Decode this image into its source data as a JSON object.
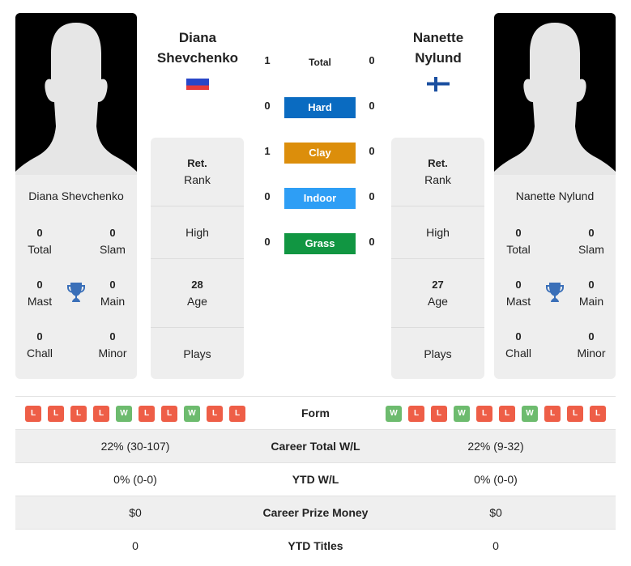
{
  "players": [
    {
      "name": "Diana Shevchenko",
      "name_line1": "Diana",
      "name_line2": "Shevchenko",
      "flag": "russia-flag",
      "titles": {
        "total": "0",
        "slam": "0",
        "mast": "0",
        "main": "0",
        "chall": "0",
        "minor": "0"
      },
      "info": {
        "rank_value": "Ret.",
        "rank_label": "Rank",
        "high_label": "High",
        "age_value": "28",
        "age_label": "Age",
        "plays_label": "Plays"
      },
      "form": [
        "L",
        "L",
        "L",
        "L",
        "W",
        "L",
        "L",
        "W",
        "L",
        "L"
      ],
      "career_wl": "22% (30-107)",
      "ytd_wl": "0% (0-0)",
      "prize_money": "$0",
      "ytd_titles": "0"
    },
    {
      "name": "Nanette Nylund",
      "name_line1": "Nanette",
      "name_line2": "Nylund",
      "flag": "finland-flag",
      "titles": {
        "total": "0",
        "slam": "0",
        "mast": "0",
        "main": "0",
        "chall": "0",
        "minor": "0"
      },
      "info": {
        "rank_value": "Ret.",
        "rank_label": "Rank",
        "high_label": "High",
        "age_value": "27",
        "age_label": "Age",
        "plays_label": "Plays"
      },
      "form": [
        "W",
        "L",
        "L",
        "W",
        "L",
        "L",
        "W",
        "L",
        "L",
        "L"
      ],
      "career_wl": "22% (9-32)",
      "ytd_wl": "0% (0-0)",
      "prize_money": "$0",
      "ytd_titles": "0"
    }
  ],
  "title_labels": {
    "total": "Total",
    "slam": "Slam",
    "mast": "Mast",
    "main": "Main",
    "chall": "Chall",
    "minor": "Minor"
  },
  "h2h": {
    "total": {
      "label": "Total",
      "left": "1",
      "right": "0"
    },
    "surfaces": [
      {
        "label": "Hard",
        "left": "0",
        "right": "0",
        "color": "#0a6bc1"
      },
      {
        "label": "Clay",
        "left": "1",
        "right": "0",
        "color": "#dc8e0b"
      },
      {
        "label": "Indoor",
        "left": "0",
        "right": "0",
        "color": "#2e9ef5"
      },
      {
        "label": "Grass",
        "left": "0",
        "right": "0",
        "color": "#119642"
      }
    ]
  },
  "comparison": {
    "form_label": "Form",
    "career_wl_label": "Career Total W/L",
    "ytd_wl_label": "YTD W/L",
    "prize_label": "Career Prize Money",
    "ytd_titles_label": "YTD Titles"
  },
  "colors": {
    "win": "#6dbb6e",
    "loss": "#ee5e47",
    "trophy": "#3a6fb8"
  }
}
